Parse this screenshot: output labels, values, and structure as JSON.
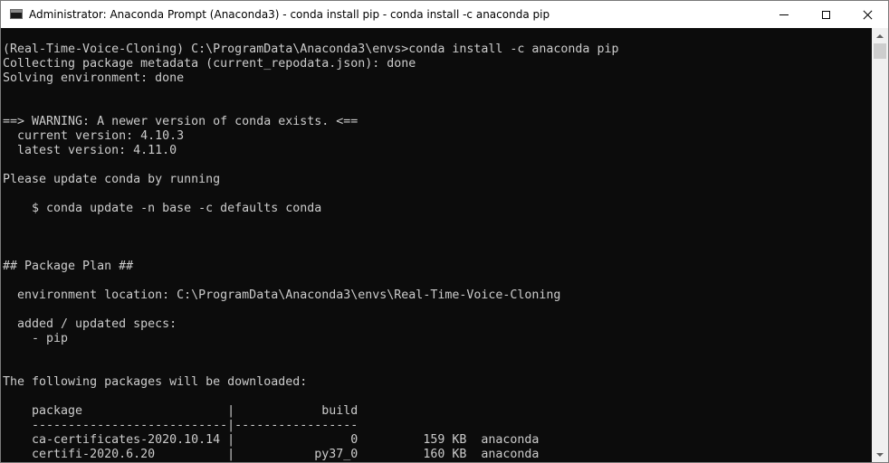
{
  "window": {
    "title": "Administrator: Anaconda Prompt (Anaconda3) - conda  install pip - conda  install -c anaconda pip",
    "icon": "console-icon",
    "controls": [
      "minimize-icon",
      "maximize-icon",
      "close-icon"
    ]
  },
  "console": {
    "lines": [
      "(Real-Time-Voice-Cloning) C:\\ProgramData\\Anaconda3\\envs>conda install -c anaconda pip",
      "Collecting package metadata (current_repodata.json): done",
      "Solving environment: done",
      "",
      "",
      "==> WARNING: A newer version of conda exists. <==",
      "  current version: 4.10.3",
      "  latest version: 4.11.0",
      "",
      "Please update conda by running",
      "",
      "    $ conda update -n base -c defaults conda",
      "",
      "",
      "",
      "## Package Plan ##",
      "",
      "  environment location: C:\\ProgramData\\Anaconda3\\envs\\Real-Time-Voice-Cloning",
      "",
      "  added / updated specs:",
      "    - pip",
      "",
      "",
      "The following packages will be downloaded:",
      "",
      "    package                    |            build",
      "    ---------------------------|-----------------",
      "    ca-certificates-2020.10.14 |                0         159 KB  anaconda",
      "    certifi-2020.6.20          |           py37_0         160 KB  anaconda"
    ]
  },
  "colors": {
    "background": "#0c0c0c",
    "text": "#cccccc",
    "titlebar": "#ffffff"
  }
}
